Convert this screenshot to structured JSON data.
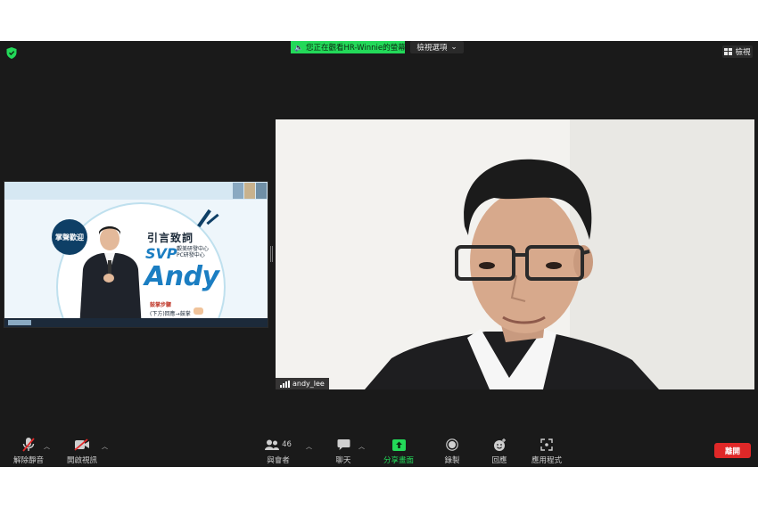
{
  "top_bar": {
    "banner_text": "您正在觀看HR-Winnie的螢幕",
    "view_options_label": "檢視選項",
    "view_button_label": "檢視"
  },
  "shared_screen": {
    "badge": "掌聲歡迎",
    "title": "引言致詞",
    "role": "SVP",
    "dept_line1": "觀美研發中心",
    "dept_line2": "PC研發中心",
    "name": "Andy",
    "line1": "鼓掌步驟",
    "line2": "(下方)回應→鼓掌"
  },
  "video": {
    "participant_name": "andy_lee"
  },
  "toolbar": {
    "unmute_label": "解除靜音",
    "start_video_label": "開啟視訊",
    "participants_label": "與會者",
    "participants_count": "46",
    "chat_label": "聊天",
    "share_label": "分享畫面",
    "record_label": "錄製",
    "reactions_label": "回應",
    "apps_label": "應用程式",
    "leave_label": "離開"
  },
  "colors": {
    "app_background": "#1a1a1a",
    "share_green": "#23d959",
    "leave_red": "#e02828",
    "accent_blue": "#1b7ec2"
  }
}
